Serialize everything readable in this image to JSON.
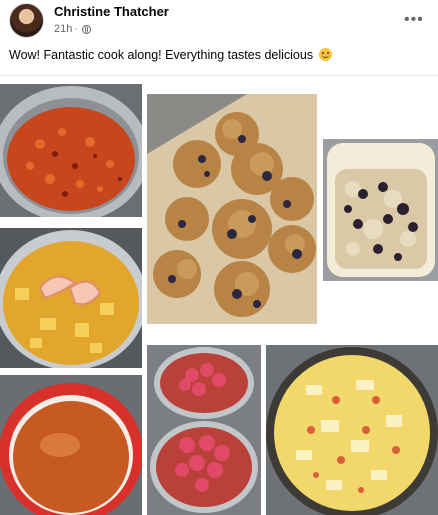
{
  "post": {
    "author": "Christine Thatcher",
    "time": "21h",
    "dot": "·",
    "visibility_icon": "globe-icon",
    "more_icon": "more-options-icon",
    "more_glyph": "•••",
    "text": "Wow! Fantastic cook along! Everything tastes delicious",
    "emoji_icon": "smiling-face-emoji"
  }
}
